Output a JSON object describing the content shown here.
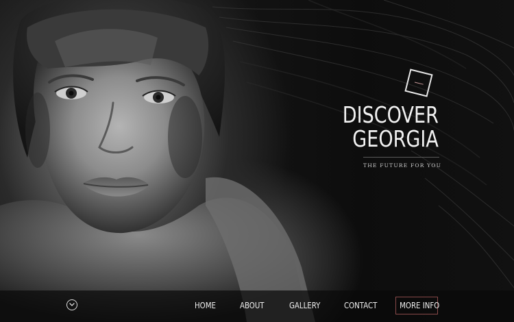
{
  "hero": {
    "title_line1": "DISCOVER",
    "title_line2": "GEORGIA",
    "subtitle": "THE FUTURE FOR YOU",
    "logo_icon": "tilted-square-logo"
  },
  "nav": {
    "scroll_icon": "chevron-down-circle-icon",
    "items": [
      {
        "label": "HOME"
      },
      {
        "label": "ABOUT"
      },
      {
        "label": "GALLERY"
      },
      {
        "label": "CONTACT"
      }
    ],
    "cta_label": "MORE INFO"
  },
  "colors": {
    "background": "#0b0b0b",
    "text": "#f2f2f2",
    "cta_border": "#8a4a4a",
    "logo_accent": "#c99a9a"
  }
}
